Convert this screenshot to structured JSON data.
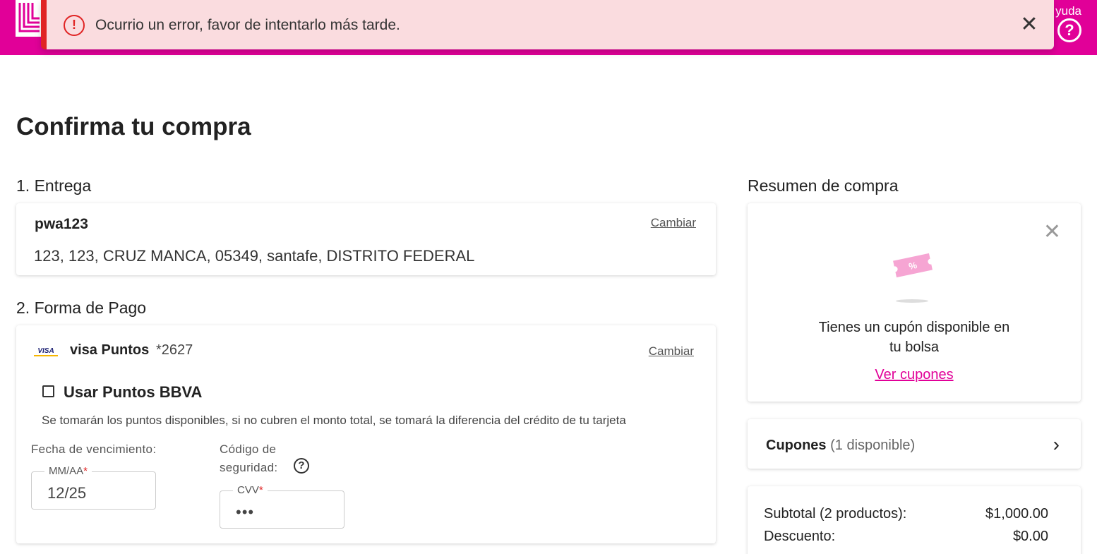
{
  "header": {
    "help_label": "yuda"
  },
  "alert": {
    "message": "Ocurrio un error, favor de intentarlo más tarde."
  },
  "page_title": "Confirma tu compra",
  "delivery": {
    "section_title": "1. Entrega",
    "name": "pwa123",
    "change_label": "Cambiar",
    "address": "123, 123, CRUZ MANCA, 05349, santafe, DISTRITO FEDERAL"
  },
  "payment": {
    "section_title": "2. Forma de Pago",
    "card_brand": "VISA",
    "card_name": "visa Puntos",
    "card_mask": "*2627",
    "change_label": "Cambiar",
    "use_points_label": "Usar Puntos BBVA",
    "use_points_checked": false,
    "points_note": "Se tomarán los puntos disponibles, si no cubren el monto total, se tomará la diferencia del crédito de tu tarjeta",
    "expiry_label": "Fecha de vencimiento:",
    "expiry_field_label": "MM/AA",
    "expiry_value": "12/25",
    "security_label_line1": "Código de",
    "security_label_line2": "seguridad:",
    "cvv_field_label": "CVV",
    "cvv_value": "•••",
    "required_mark": "*"
  },
  "summary": {
    "section_title": "Resumen de compra",
    "coupon_notice_line1": "Tienes un cupón disponible en",
    "coupon_notice_line2": "tu bolsa",
    "coupon_ticket_symbol": "%",
    "view_coupons_label": "Ver cupones",
    "coupons_label": "Cupones",
    "coupons_available": "(1 disponible)",
    "rows": [
      {
        "label": "Subtotal (2 productos):",
        "value": "$1,000.00"
      },
      {
        "label": "Descuento:",
        "value": "$0.00"
      }
    ]
  },
  "colors": {
    "brand": "#e10098",
    "alert_bg": "#fadcdf",
    "alert_accent": "#e02424"
  }
}
